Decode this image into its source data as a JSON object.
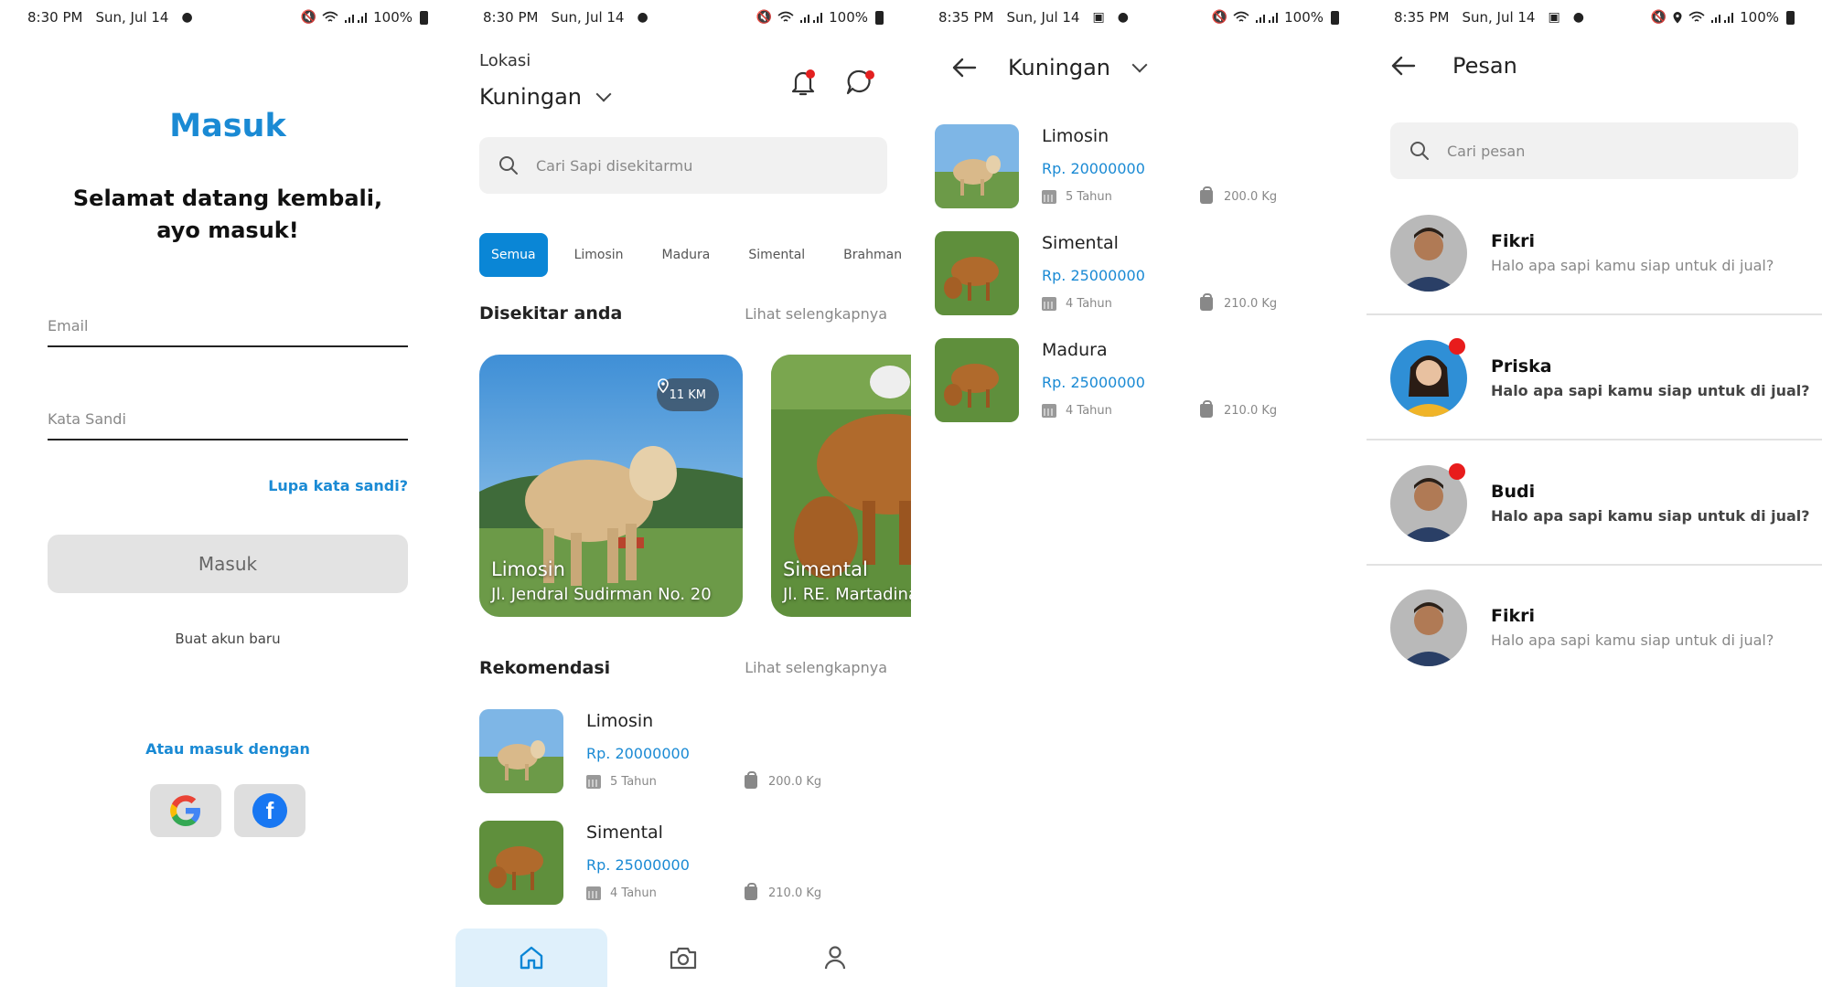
{
  "screens": {
    "login": {
      "status": {
        "time": "8:30 PM",
        "date": "Sun, Jul 14",
        "battery": "100%"
      },
      "title": "Masuk",
      "welcome_line1": "Selamat datang kembali,",
      "welcome_line2": "ayo masuk!",
      "email_placeholder": "Email",
      "password_placeholder": "Kata Sandi",
      "forgot_label": "Lupa kata sandi?",
      "login_label": "Masuk",
      "register_label": "Buat akun baru",
      "alt_login_label": "Atau masuk dengan",
      "facebook_glyph": "f"
    },
    "home": {
      "status": {
        "time": "8:30 PM",
        "date": "Sun, Jul 14",
        "battery": "100%"
      },
      "location_label": "Lokasi",
      "location_value": "Kuningan",
      "search_placeholder": "Cari Sapi disekitarmu",
      "chips": [
        "Semua",
        "Limosin",
        "Madura",
        "Simental",
        "Brahman"
      ],
      "nearby_title": "Disekitar anda",
      "nearby_link": "Lihat selengkapnya",
      "nearby_cards": [
        {
          "name": "Limosin",
          "address": "Jl. Jendral Sudirman No. 20",
          "distance": "11 KM"
        },
        {
          "name": "Simental",
          "address": "Jl. RE. Martadinata"
        }
      ],
      "recommend_title": "Rekomendasi",
      "recommend_link": "Lihat selengkapnya",
      "recommend_items": [
        {
          "name": "Limosin",
          "price": "Rp. 20000000",
          "age": "5 Tahun",
          "weight": "200.0 Kg"
        },
        {
          "name": "Simental",
          "price": "Rp. 25000000",
          "age": "4 Tahun",
          "weight": "210.0 Kg"
        }
      ]
    },
    "listing": {
      "status": {
        "time": "8:35 PM",
        "date": "Sun, Jul 14",
        "battery": "100%"
      },
      "title": "Kuningan",
      "items": [
        {
          "name": "Limosin",
          "price": "Rp. 20000000",
          "age": "5 Tahun",
          "weight": "200.0 Kg"
        },
        {
          "name": "Simental",
          "price": "Rp. 25000000",
          "age": "4 Tahun",
          "weight": "210.0 Kg"
        },
        {
          "name": "Madura",
          "price": "Rp. 25000000",
          "age": "4 Tahun",
          "weight": "210.0 Kg"
        }
      ]
    },
    "messages": {
      "status": {
        "time": "8:35 PM",
        "date": "Sun, Jul 14",
        "battery": "100%"
      },
      "title": "Pesan",
      "search_placeholder": "Cari pesan",
      "chats": [
        {
          "name": "Fikri",
          "message": "Halo apa sapi kamu siap untuk di jual?",
          "unread": false
        },
        {
          "name": "Priska",
          "message": "Halo apa sapi kamu siap untuk di jual?",
          "unread": true
        },
        {
          "name": "Budi",
          "message": "Halo apa sapi kamu siap untuk di jual?",
          "unread": true
        },
        {
          "name": "Fikri",
          "message": "Halo apa sapi kamu siap untuk di jual?",
          "unread": false
        }
      ]
    }
  },
  "colors": {
    "accent": "#1a8ad4",
    "chip_active": "#0a86d6",
    "badge": "#e81c1c"
  }
}
